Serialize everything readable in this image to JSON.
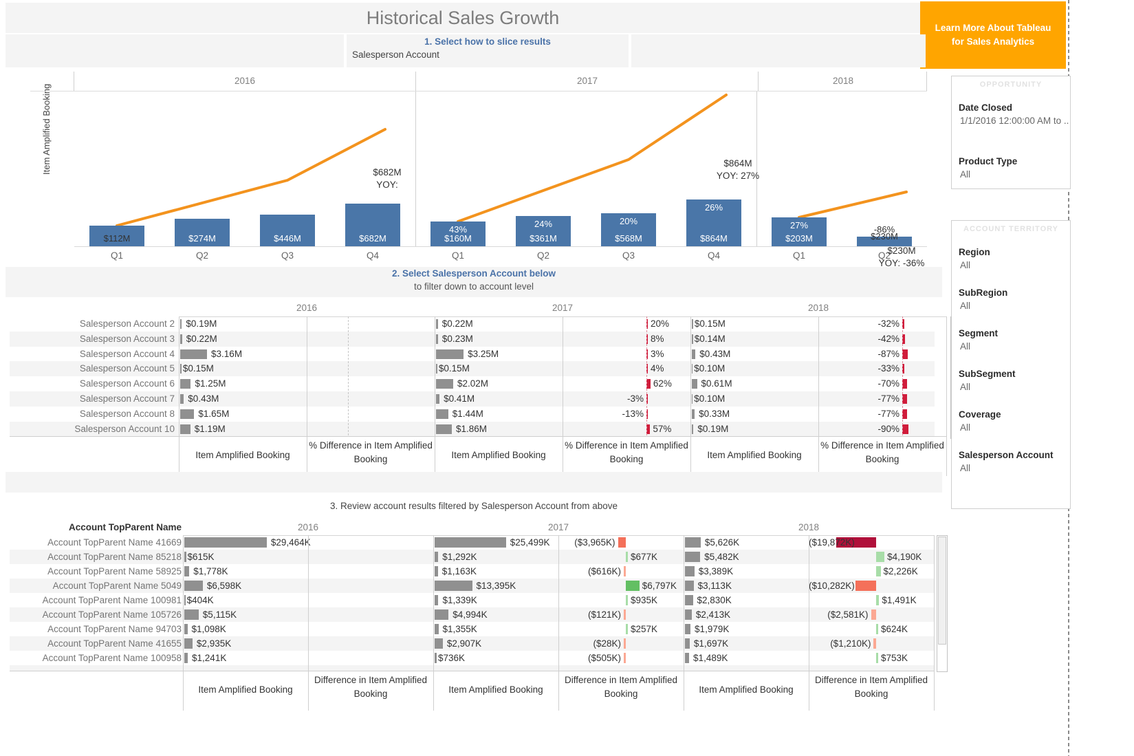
{
  "header": {
    "title": "Historical Sales Growth",
    "slice_prompt": "1. Select how to slice results",
    "slice_value": "Salesperson Account",
    "cta_label": "Learn More About Tableau for Sales Analytics"
  },
  "chart_data": {
    "type": "bar",
    "title": "Historical Sales Growth",
    "ylabel": "Item Amplified Booking",
    "xlabel": "",
    "grid": false,
    "legend": "none",
    "groups": [
      {
        "year": "2016",
        "categories": [
          "Q1",
          "Q2",
          "Q3",
          "Q4"
        ],
        "values": [
          112,
          274,
          446,
          682
        ],
        "value_labels": [
          "$112M",
          "$274M",
          "$446M",
          "$682M"
        ],
        "pct_labels": [
          "",
          "",
          "",
          ""
        ],
        "annotation": {
          "value": "$682M",
          "yoy": "YOY:"
        }
      },
      {
        "year": "2017",
        "categories": [
          "Q1",
          "Q2",
          "Q3",
          "Q4"
        ],
        "values": [
          160,
          361,
          568,
          864
        ],
        "value_labels": [
          "$160M",
          "$361M",
          "$568M",
          "$864M"
        ],
        "pct_labels": [
          "43%",
          "24%",
          "20%",
          "26%"
        ],
        "annotation": {
          "value": "$864M",
          "yoy": "YOY: 27%"
        }
      },
      {
        "year": "2018",
        "categories": [
          "Q1",
          "Q2"
        ],
        "values": [
          203,
          230
        ],
        "value_labels": [
          "$203M",
          "$230M"
        ],
        "pct_labels": [
          "27%",
          "-86%"
        ],
        "annotation": {
          "value": "$230M",
          "yoy": "YOY: -36%"
        }
      }
    ],
    "units": "$M",
    "line_color": "#f3931e",
    "bar_color": "#4a76a8"
  },
  "middle": {
    "prompt_line1": "2. Select Salesperson Account below",
    "prompt_line2": "to filter down to account level",
    "years": [
      "2016",
      "2017",
      "2018"
    ],
    "measure_headers": [
      "Item Amplified Booking",
      "% Difference in Item Amplified Booking",
      "Item Amplified Booking",
      "% Difference in Item Amplified Booking",
      "Item Amplified Booking",
      "% Difference in Item Amplified Booking"
    ],
    "rows": [
      {
        "label": "Salesperson Account 2",
        "v2016": "$0.19M",
        "b2016": 0.19,
        "d2016": "",
        "v2017": "$0.22M",
        "b2017": 0.22,
        "d2017": "20%",
        "dv2017": 20,
        "v2018": "$0.15M",
        "b2018": 0.15,
        "d2018": "-32%",
        "dv2018": -32
      },
      {
        "label": "Salesperson Account 3",
        "v2016": "$0.22M",
        "b2016": 0.22,
        "d2016": "",
        "v2017": "$0.23M",
        "b2017": 0.23,
        "d2017": "8%",
        "dv2017": 8,
        "v2018": "$0.14M",
        "b2018": 0.14,
        "d2018": "-42%",
        "dv2018": -42
      },
      {
        "label": "Salesperson Account 4",
        "v2016": "$3.16M",
        "b2016": 3.16,
        "d2016": "",
        "v2017": "$3.25M",
        "b2017": 3.25,
        "d2017": "3%",
        "dv2017": 3,
        "v2018": "$0.43M",
        "b2018": 0.43,
        "d2018": "-87%",
        "dv2018": -87
      },
      {
        "label": "Salesperson Account 5",
        "v2016": "$0.15M",
        "b2016": 0.15,
        "d2016": "",
        "v2017": "$0.15M",
        "b2017": 0.15,
        "d2017": "4%",
        "dv2017": 4,
        "v2018": "$0.10M",
        "b2018": 0.1,
        "d2018": "-33%",
        "dv2018": -33
      },
      {
        "label": "Salesperson Account 6",
        "v2016": "$1.25M",
        "b2016": 1.25,
        "d2016": "",
        "v2017": "$2.02M",
        "b2017": 2.02,
        "d2017": "62%",
        "dv2017": 62,
        "v2018": "$0.61M",
        "b2018": 0.61,
        "d2018": "-70%",
        "dv2018": -70
      },
      {
        "label": "Salesperson Account 7",
        "v2016": "$0.43M",
        "b2016": 0.43,
        "d2016": "",
        "v2017": "$0.41M",
        "b2017": 0.41,
        "d2017": "-3%",
        "dv2017": -3,
        "v2018": "$0.10M",
        "b2018": 0.1,
        "d2018": "-77%",
        "dv2018": -77
      },
      {
        "label": "Salesperson Account 8",
        "v2016": "$1.65M",
        "b2016": 1.65,
        "d2016": "",
        "v2017": "$1.44M",
        "b2017": 1.44,
        "d2017": "-13%",
        "dv2017": -13,
        "v2018": "$0.33M",
        "b2018": 0.33,
        "d2018": "-77%",
        "dv2018": -77
      },
      {
        "label": "Salesperson Account 10",
        "v2016": "$1.19M",
        "b2016": 1.19,
        "d2016": "",
        "v2017": "$1.86M",
        "b2017": 1.86,
        "d2017": "57%",
        "dv2017": 57,
        "v2018": "$0.19M",
        "b2018": 0.19,
        "d2018": "-90%",
        "dv2018": -90
      }
    ]
  },
  "bottom": {
    "prompt": "3. Review account results filtered by Salesperson Account from above",
    "corner_header": "Account TopParent Name",
    "years": [
      "2016",
      "2017",
      "2018"
    ],
    "measure_headers": [
      "Item Amplified Booking",
      "Difference in Item Amplified Booking",
      "Item Amplified Booking",
      "Difference in Item Amplified Booking",
      "Item Amplified Booking",
      "Difference in Item Amplified Booking"
    ],
    "rows": [
      {
        "label": "Account TopParent Name 41669",
        "v2016": "$29,464K",
        "b2016": 29464,
        "d2016": "",
        "dv2016": 0,
        "v2017": "$25,499K",
        "b2017": 25499,
        "d2017": "($3,965K)",
        "dv2017": -3965,
        "v2018": "$5,626K",
        "b2018": 5626,
        "d2018": "($19,872K)",
        "dv2018": -19872
      },
      {
        "label": "Account TopParent Name 85218",
        "v2016": "$615K",
        "b2016": 615,
        "d2016": "",
        "dv2016": 0,
        "v2017": "$1,292K",
        "b2017": 1292,
        "d2017": "$677K",
        "dv2017": 677,
        "v2018": "$5,482K",
        "b2018": 5482,
        "d2018": "$4,190K",
        "dv2018": 4190
      },
      {
        "label": "Account TopParent Name 58925",
        "v2016": "$1,778K",
        "b2016": 1778,
        "d2016": "",
        "dv2016": 0,
        "v2017": "$1,163K",
        "b2017": 1163,
        "d2017": "($616K)",
        "dv2017": -616,
        "v2018": "$3,389K",
        "b2018": 3389,
        "d2018": "$2,226K",
        "dv2018": 2226
      },
      {
        "label": "Account TopParent Name 5049",
        "v2016": "$6,598K",
        "b2016": 6598,
        "d2016": "",
        "dv2016": 0,
        "v2017": "$13,395K",
        "b2017": 13395,
        "d2017": "$6,797K",
        "dv2017": 6797,
        "v2018": "$3,113K",
        "b2018": 3113,
        "d2018": "($10,282K)",
        "dv2018": -10282
      },
      {
        "label": "Account TopParent Name 100981",
        "v2016": "$404K",
        "b2016": 404,
        "d2016": "",
        "dv2016": 0,
        "v2017": "$1,339K",
        "b2017": 1339,
        "d2017": "$935K",
        "dv2017": 935,
        "v2018": "$2,830K",
        "b2018": 2830,
        "d2018": "$1,491K",
        "dv2018": 1491
      },
      {
        "label": "Account TopParent Name 105726",
        "v2016": "$5,115K",
        "b2016": 5115,
        "d2016": "",
        "dv2016": 0,
        "v2017": "$4,994K",
        "b2017": 4994,
        "d2017": "($121K)",
        "dv2017": -121,
        "v2018": "$2,413K",
        "b2018": 2413,
        "d2018": "($2,581K)",
        "dv2018": -2581
      },
      {
        "label": "Account TopParent Name 94703",
        "v2016": "$1,098K",
        "b2016": 1098,
        "d2016": "",
        "dv2016": 0,
        "v2017": "$1,355K",
        "b2017": 1355,
        "d2017": "$257K",
        "dv2017": 257,
        "v2018": "$1,979K",
        "b2018": 1979,
        "d2018": "$624K",
        "dv2018": 624
      },
      {
        "label": "Account TopParent Name 41655",
        "v2016": "$2,935K",
        "b2016": 2935,
        "d2016": "",
        "dv2016": 0,
        "v2017": "$2,907K",
        "b2017": 2907,
        "d2017": "($28K)",
        "dv2017": -28,
        "v2018": "$1,697K",
        "b2018": 1697,
        "d2018": "($1,210K)",
        "dv2018": -1210
      },
      {
        "label": "Account TopParent Name 100958",
        "v2016": "$1,241K",
        "b2016": 1241,
        "d2016": "",
        "dv2016": 0,
        "v2017": "$736K",
        "b2017": 736,
        "d2017": "($505K)",
        "dv2017": -505,
        "v2018": "$1,489K",
        "b2018": 1489,
        "d2018": "$753K",
        "dv2018": 753
      }
    ]
  },
  "filters": {
    "opportunity": {
      "title": "OPPORTUNITY",
      "fields": [
        {
          "name": "Date Closed",
          "value": "1/1/2016 12:00:00 AM to .."
        },
        {
          "name": "Product Type",
          "value": "All"
        }
      ]
    },
    "account_territory": {
      "title": "ACCOUNT TERRITORY",
      "fields": [
        {
          "name": "Region",
          "value": "All"
        },
        {
          "name": "SubRegion",
          "value": "All"
        },
        {
          "name": "Segment",
          "value": "All"
        },
        {
          "name": "SubSegment",
          "value": "All"
        },
        {
          "name": "Coverage",
          "value": "All"
        },
        {
          "name": "Salesperson Account",
          "value": "All"
        }
      ]
    }
  }
}
